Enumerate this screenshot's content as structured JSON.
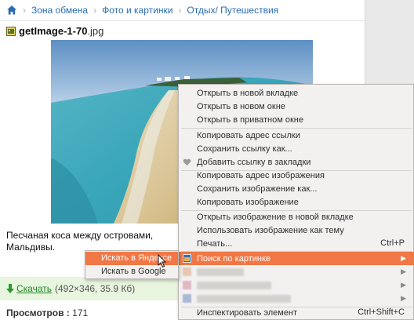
{
  "breadcrumb": {
    "items": [
      "Зона обмена",
      "Фото и картинки",
      "Отдых/ Путешествия"
    ]
  },
  "file": {
    "name": "getImage-1-70",
    "ext": ".jpg"
  },
  "caption": "Песчаная коса между островами, Мальдивы.",
  "download": {
    "link": "Скачать",
    "meta": "(492×346, 35.9 Кб)"
  },
  "views": {
    "label": "Просмотров :",
    "count": "171"
  },
  "context_menu": {
    "items": [
      {
        "label": "Открыть в новой вкладке"
      },
      {
        "label": "Открыть в новом окне"
      },
      {
        "label": "Открыть в приватном окне"
      },
      {
        "label": "Копировать адрес ссылки"
      },
      {
        "label": "Сохранить ссылку как..."
      },
      {
        "label": "Добавить ссылку в закладки"
      },
      {
        "label": "Копировать адрес изображения"
      },
      {
        "label": "Сохранить изображение как..."
      },
      {
        "label": "Копировать изображение"
      },
      {
        "label": "Открыть изображение в новой вкладке"
      },
      {
        "label": "Использовать изображение как тему"
      },
      {
        "label": "Печать...",
        "shortcut": "Ctrl+P"
      },
      {
        "label": "Поиск по картинке"
      },
      {
        "label": "Инспектировать элемент",
        "shortcut": "Ctrl+Shift+C"
      }
    ]
  },
  "submenu": {
    "items": [
      "Искать в Яндексе",
      "Искать в Google"
    ]
  },
  "colors": {
    "accent": "#f07746",
    "link": "#2a6db0",
    "download_bg": "#e8f5df",
    "download_link": "#1f8a1f"
  }
}
